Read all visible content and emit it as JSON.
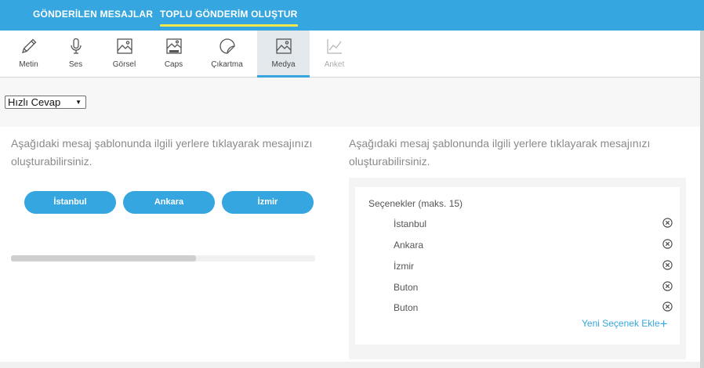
{
  "top_tabs": [
    {
      "label": "GÖNDERİLEN MESAJLAR"
    },
    {
      "label": "TOPLU GÖNDERİM OLUŞTUR"
    }
  ],
  "tools": [
    {
      "label": "Metin",
      "icon": "pencil-icon"
    },
    {
      "label": "Ses",
      "icon": "microphone-icon"
    },
    {
      "label": "Görsel",
      "icon": "image-icon"
    },
    {
      "label": "Caps",
      "icon": "caps-image-icon"
    },
    {
      "label": "Çıkartma",
      "icon": "sticker-icon"
    },
    {
      "label": "Medya",
      "icon": "media-icon"
    },
    {
      "label": "Anket",
      "icon": "chart-line-icon"
    }
  ],
  "active_tool": "Medya",
  "quick_reply": {
    "selected": "Hızlı Cevap"
  },
  "left": {
    "description": "Aşağıdaki mesaj şablonunda ilgili yerlere tıklayarak mesajınızı oluşturabilirsiniz.",
    "buttons": [
      "İstanbul",
      "Ankara",
      "İzmir"
    ]
  },
  "right": {
    "description": "Aşağıdaki mesaj şablonunda ilgili yerlere tıklayarak mesajınızı oluşturabilirsiniz.",
    "options_header": "Seçenekler (maks. 15)",
    "options": [
      "İstanbul",
      "Ankara",
      "İzmir",
      "Buton",
      "Buton"
    ],
    "add_option": "Yeni Seçenek Ekle"
  },
  "colors": {
    "accent": "#35a6df",
    "tab_underline": "#f2e84d"
  }
}
